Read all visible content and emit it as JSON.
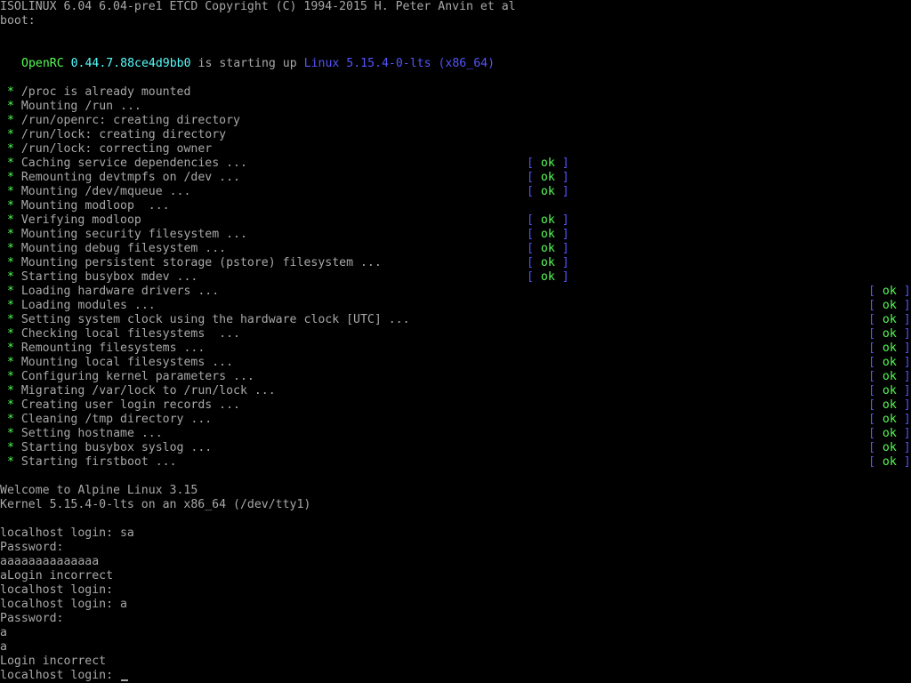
{
  "header": {
    "bootloader_line": "ISOLINUX 6.04 6.04-pre1 ETCD Copyright (C) 1994-2015 H. Peter Anvin et al",
    "boot_prompt": "boot:"
  },
  "openrc": {
    "name": "OpenRC",
    "version": "0.44.7.88ce4d9bb0",
    "middle_text": "is starting up",
    "kernel": "Linux 5.15.4-0-lts (x86_64)"
  },
  "status_marker": {
    "bullet": "*",
    "open": "[",
    "ok": "ok",
    "close": "]"
  },
  "messages": [
    {
      "text": "/proc is already mounted",
      "status": ""
    },
    {
      "text": "Mounting /run ...",
      "status": ""
    },
    {
      "text": "/run/openrc: creating directory",
      "status": ""
    },
    {
      "text": "/run/lock: creating directory",
      "status": ""
    },
    {
      "text": "/run/lock: correcting owner",
      "status": ""
    },
    {
      "text": "Caching service dependencies ...",
      "status": "ok"
    },
    {
      "text": "Remounting devtmpfs on /dev ...",
      "status": "ok"
    },
    {
      "text": "Mounting /dev/mqueue ...",
      "status": "ok"
    },
    {
      "text": "Mounting modloop  ...",
      "status": ""
    },
    {
      "text": "Verifying modloop",
      "status": "ok"
    },
    {
      "text": "Mounting security filesystem ...",
      "status": "ok"
    },
    {
      "text": "Mounting debug filesystem ...",
      "status": "ok"
    },
    {
      "text": "Mounting persistent storage (pstore) filesystem ...",
      "status": "ok"
    },
    {
      "text": "Starting busybox mdev ...",
      "status": "ok"
    },
    {
      "text": "Loading hardware drivers ...",
      "status": "ok"
    },
    {
      "text": "Loading modules ...",
      "status": "ok"
    },
    {
      "text": "Setting system clock using the hardware clock [UTC] ...",
      "status": "ok"
    },
    {
      "text": "Checking local filesystems  ...",
      "status": "ok"
    },
    {
      "text": "Remounting filesystems ...",
      "status": "ok"
    },
    {
      "text": "Mounting local filesystems ...",
      "status": "ok"
    },
    {
      "text": "Configuring kernel parameters ...",
      "status": "ok"
    },
    {
      "text": "Migrating /var/lock to /run/lock ...",
      "status": "ok"
    },
    {
      "text": "Creating user login records ...",
      "status": "ok"
    },
    {
      "text": "Cleaning /tmp directory ...",
      "status": "ok"
    },
    {
      "text": "Setting hostname ...",
      "status": "ok"
    },
    {
      "text": "Starting busybox syslog ...",
      "status": "ok"
    },
    {
      "text": "Starting firstboot ...",
      "status": "ok"
    }
  ],
  "welcome": {
    "line1": "Welcome to Alpine Linux 3.15",
    "line2": "Kernel 5.15.4-0-lts on an x86_64 (/dev/tty1)"
  },
  "login_session": [
    "localhost login: sa",
    "Password:",
    "aaaaaaaaaaaaaa",
    "aLogin incorrect",
    "localhost login:",
    "localhost login: a",
    "Password:",
    "a",
    "a",
    "Login incorrect",
    "localhost login:"
  ],
  "colors": {
    "background": "#000000",
    "text": "#a8a8a8",
    "bullet_green": "#54fc54",
    "ok_green": "#54fc54",
    "bracket_blue": "#5454fc",
    "cyan": "#54fcfc"
  }
}
